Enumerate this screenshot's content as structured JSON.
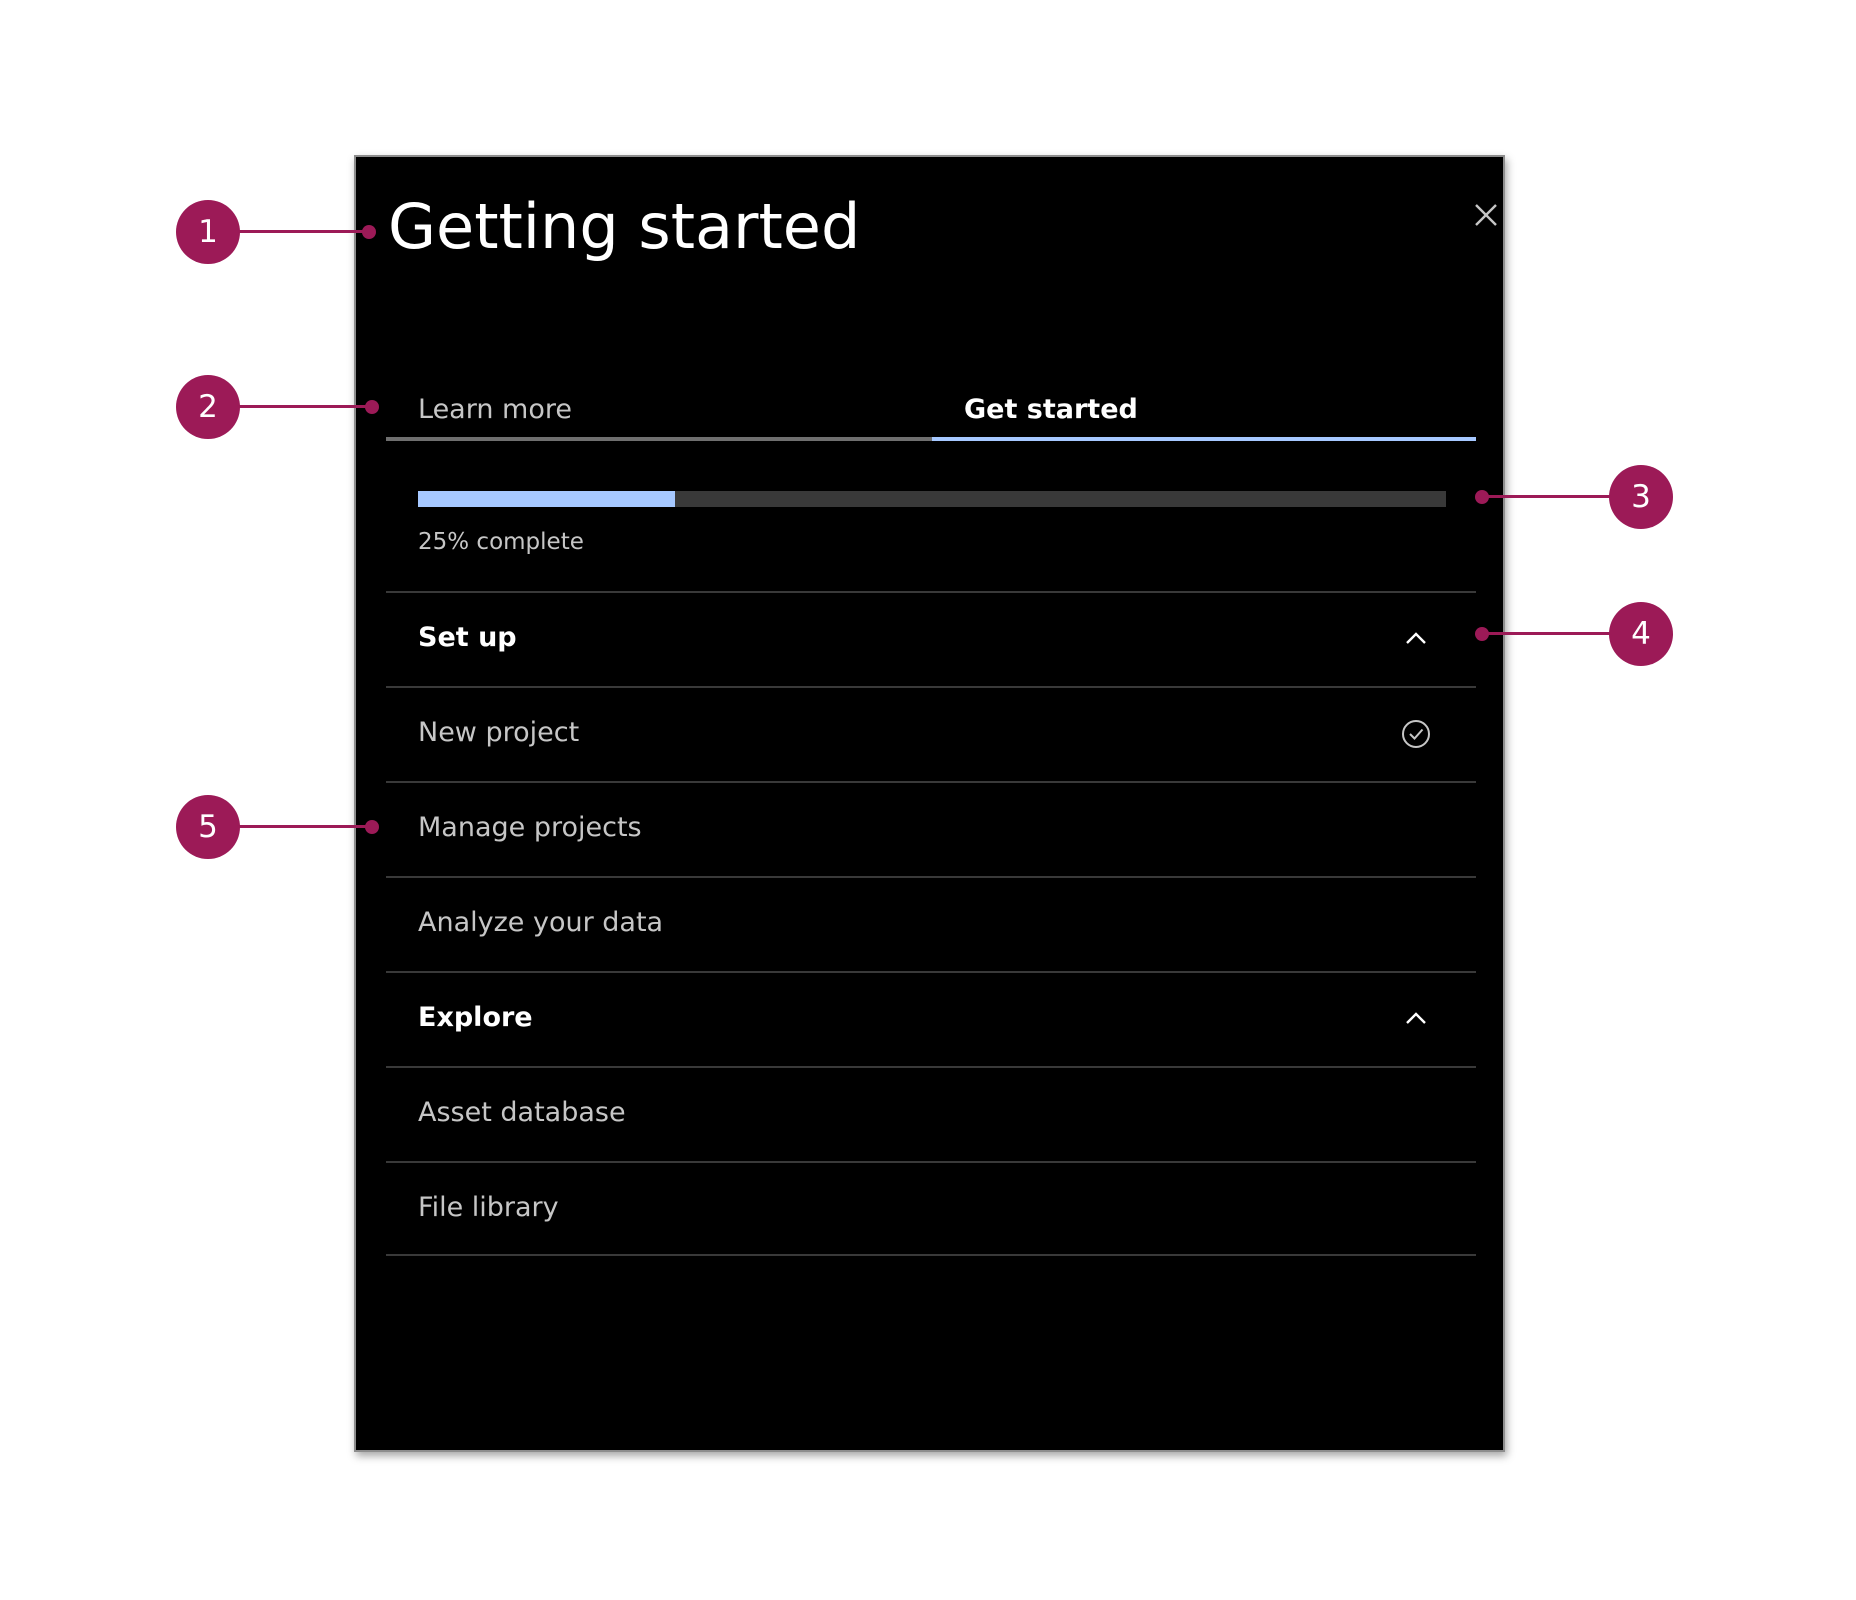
{
  "panel": {
    "title": "Getting started",
    "close_icon": "close-icon"
  },
  "tabs": [
    {
      "label": "Learn more",
      "selected": false
    },
    {
      "label": "Get started",
      "selected": true
    }
  ],
  "progress": {
    "fraction": 0.25,
    "label": "25% complete"
  },
  "sections": [
    {
      "title": "Set up",
      "icon": "chevron-up-icon",
      "items": [
        {
          "label": "New project",
          "icon": "checkmark-circle-icon"
        },
        {
          "label": "Manage projects"
        },
        {
          "label": "Analyze your data"
        }
      ]
    },
    {
      "title": "Explore",
      "icon": "chevron-up-icon",
      "items": [
        {
          "label": "Asset database"
        },
        {
          "label": "File library"
        }
      ]
    }
  ],
  "callouts": [
    "1",
    "2",
    "3",
    "4",
    "5"
  ],
  "colors": {
    "callout": "#9c1a57",
    "accent": "#a6c8ff",
    "panel_bg": "#000000"
  }
}
